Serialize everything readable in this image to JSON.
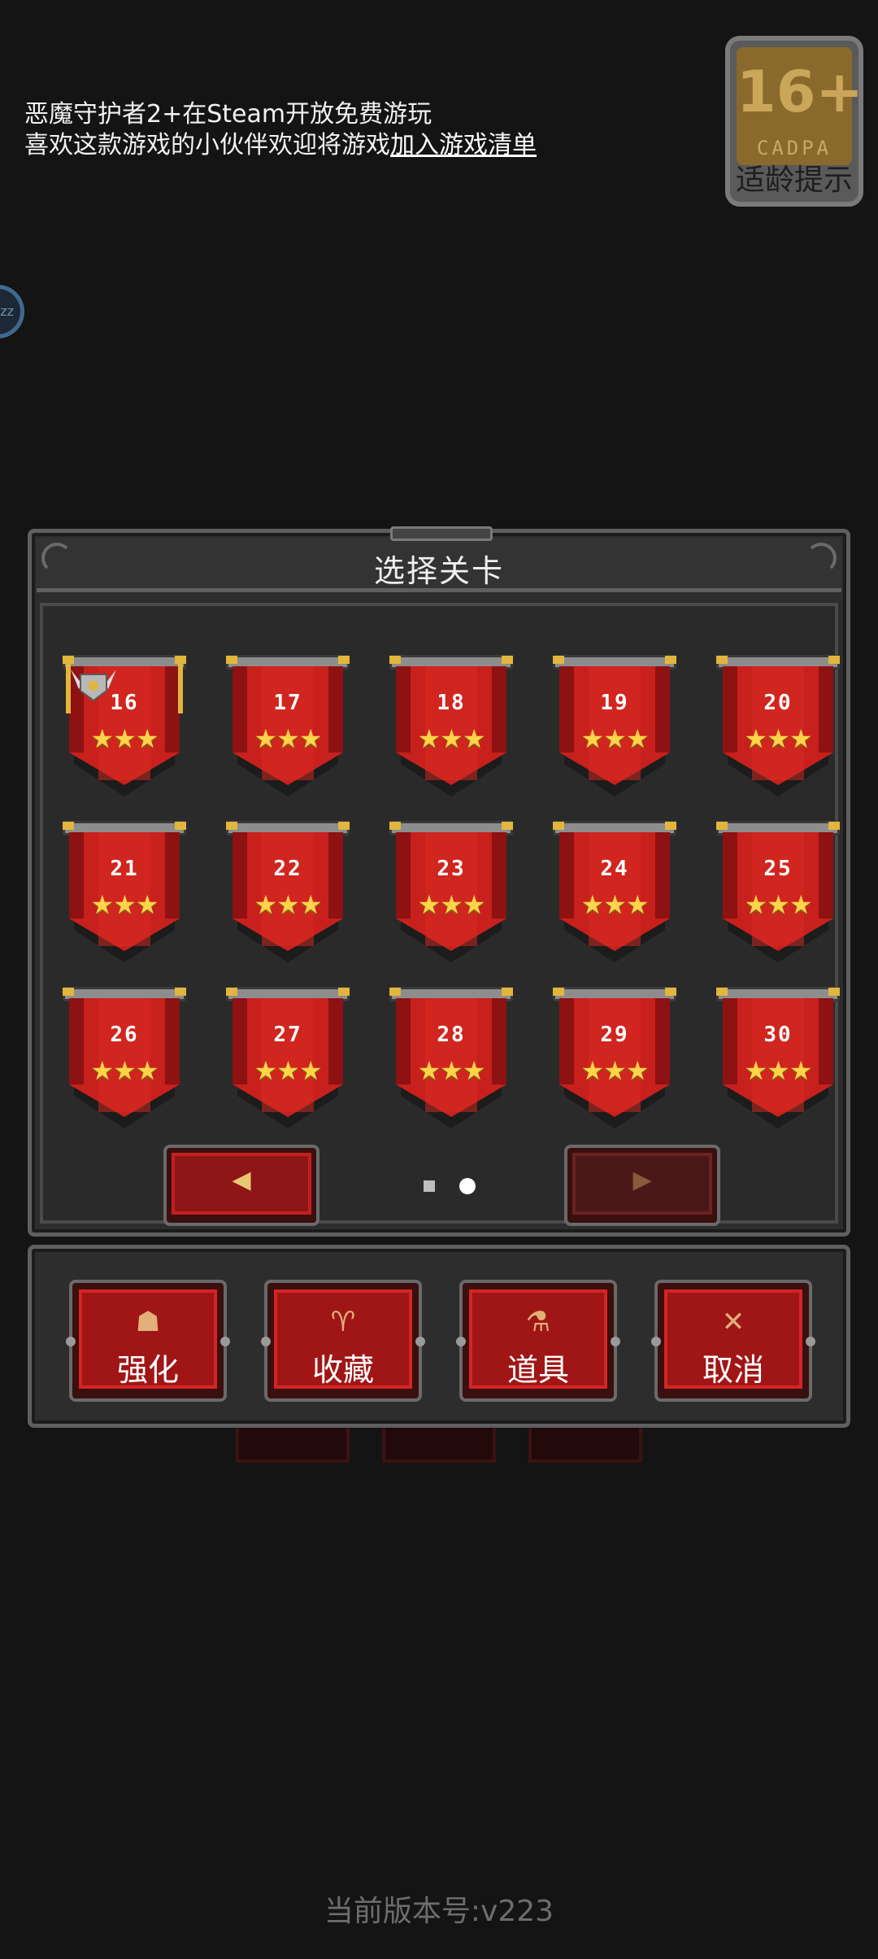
{
  "notice": {
    "line1": "恶魔守护者2+在Steam开放免费游玩",
    "line2_prefix": "喜欢这款游戏的小伙伴欢迎将游戏",
    "line2_link": "加入游戏清单"
  },
  "age_badge": {
    "rating": "16+",
    "org": "CADPA",
    "tip": "适龄提示"
  },
  "side_bubble": {
    "text": "zz"
  },
  "level_select": {
    "title": "选择关卡",
    "stars_text": "★★★",
    "levels": [
      "16",
      "17",
      "18",
      "19",
      "20",
      "21",
      "22",
      "23",
      "24",
      "25",
      "26",
      "27",
      "28",
      "29",
      "30"
    ],
    "stars_per_level": 3,
    "current_page": 2,
    "total_pages": 2,
    "prev_arrow": "◀",
    "next_arrow": "▶"
  },
  "actions": [
    {
      "icon": "☗",
      "icon_name": "helmet-icon",
      "label": "强化"
    },
    {
      "icon": "♈",
      "icon_name": "trophy-icon",
      "label": "收藏"
    },
    {
      "icon": "⚗",
      "icon_name": "potion-icon",
      "label": "道具"
    },
    {
      "icon": "✕",
      "icon_name": "close-icon",
      "label": "取消"
    }
  ],
  "version": "当前版本号:v223",
  "colors": {
    "banner_red": "#c8201c",
    "banner_dark": "#8e1212",
    "star": "#ffd34a",
    "panel": "#2d2d2d"
  }
}
